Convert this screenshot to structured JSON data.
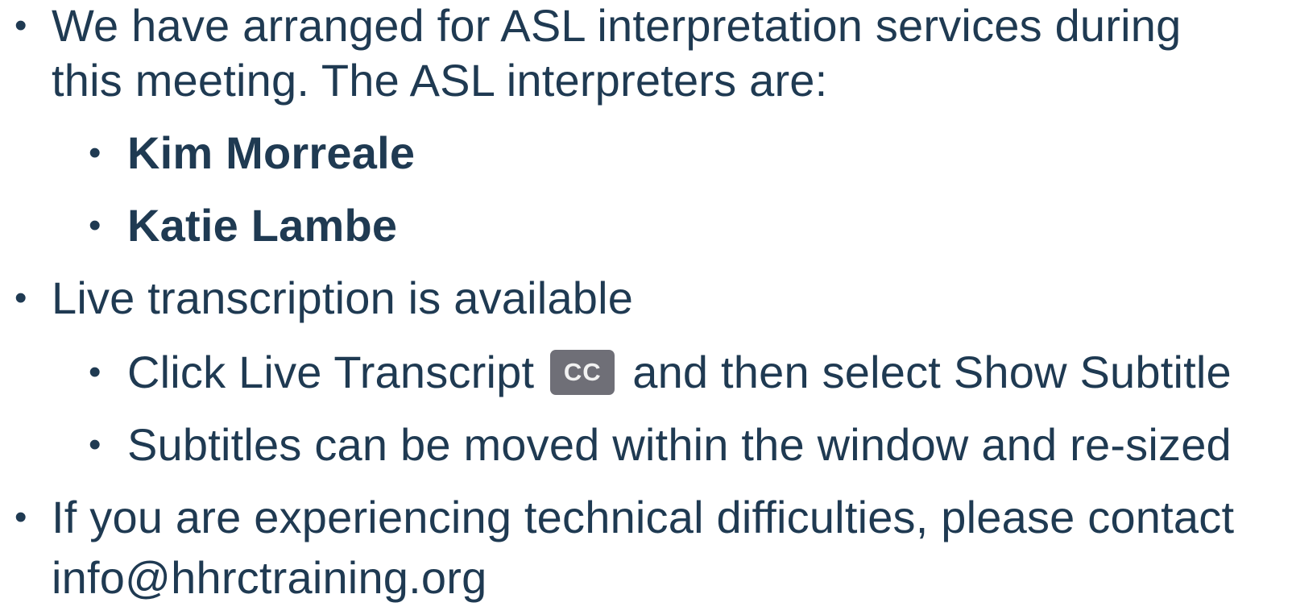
{
  "slide": {
    "items": [
      {
        "lines": [
          "We have arranged for ASL interpretation services during",
          "this meeting. The ASL interpreters are:"
        ],
        "subitems": [
          "Kim Morreale",
          "Katie Lambe"
        ]
      },
      {
        "lines": [
          "Live transcription is available"
        ],
        "subitems": [
          {
            "before_icon": "Click Live Transcript",
            "icon": "closed-captions-icon",
            "icon_label": "CC",
            "after_icon": "and then select Show Subtitle"
          },
          "Subtitles can be moved within the window and re-sized"
        ]
      },
      {
        "lines": [
          "If you are experiencing technical difficulties, please contact",
          "info@hhrctraining.org"
        ]
      }
    ]
  },
  "colors": {
    "text": "#1f3a52",
    "cc_icon_bg": "#6f6f77",
    "cc_icon_text": "#f2f2f2"
  }
}
